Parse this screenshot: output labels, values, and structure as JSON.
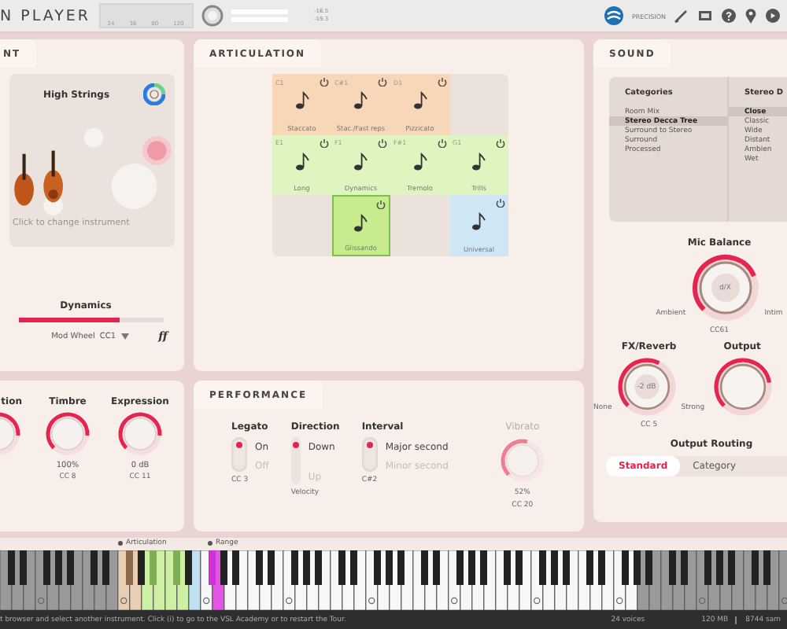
{
  "top_bar": {
    "title": "N PLAYER",
    "meter_ticks": [
      "24",
      "36",
      "80",
      "120"
    ],
    "readings": [
      "-16.5",
      "-19.3"
    ],
    "brand": "PRECISION"
  },
  "instrument_panel": {
    "tab": "NT",
    "name": "High Strings",
    "hint": "Click to change instrument",
    "dynamics": {
      "label": "Dynamics",
      "level": 0.7,
      "controller": "Mod Wheel",
      "cc": "CC1",
      "marking": "ff"
    },
    "knobs": [
      {
        "label": "tion"
      },
      {
        "label": "Timbre",
        "value": "100%",
        "cc": "CC 8"
      },
      {
        "label": "Expression",
        "value": "0 dB",
        "cc": "CC 11"
      }
    ]
  },
  "articulation": {
    "tab": "ARTICULATION",
    "cells": [
      {
        "kind": "articulation",
        "key": "C1",
        "name": "Staccato",
        "color": "#f8d6b8",
        "selected": false
      },
      {
        "kind": "articulation",
        "key": "C#1",
        "name": "Stac./Fast reps",
        "color": "#f8d6b8",
        "selected": false
      },
      {
        "kind": "articulation",
        "key": "D1",
        "name": "Pizzicato",
        "color": "#f8d6b8",
        "selected": false
      },
      {
        "kind": "empty"
      },
      {
        "kind": "articulation",
        "key": "E1",
        "name": "Long",
        "color": "#def5c0",
        "selected": false
      },
      {
        "kind": "articulation",
        "key": "F1",
        "name": "Dynamics",
        "color": "#def5c0",
        "selected": false
      },
      {
        "kind": "articulation",
        "key": "F#1",
        "name": "Tremolo",
        "color": "#def5c0",
        "selected": false
      },
      {
        "kind": "articulation",
        "key": "G1",
        "name": "Trills",
        "color": "#def5c0",
        "selected": false
      },
      {
        "kind": "empty"
      },
      {
        "kind": "articulation",
        "name": "Glissando",
        "color": "#c6ec8e",
        "selected": true
      },
      {
        "kind": "empty"
      },
      {
        "kind": "articulation",
        "name": "Universal",
        "color": "#cfe6f4",
        "selected": false
      }
    ]
  },
  "performance": {
    "tab": "PERFORMANCE",
    "legato": {
      "label": "Legato",
      "options": [
        {
          "label": "On",
          "selected": true
        },
        {
          "label": "Off",
          "selected": false
        }
      ],
      "cc": "CC 3"
    },
    "direction": {
      "label": "Direction",
      "options": [
        {
          "label": "Down",
          "selected": true
        },
        {
          "label": "Up",
          "selected": false
        }
      ],
      "note": "Velocity"
    },
    "interval": {
      "label": "Interval",
      "options": [
        {
          "label": "Major second",
          "selected": true
        },
        {
          "label": "Minor second",
          "selected": false
        }
      ],
      "cc": "C#2"
    },
    "vibrato": {
      "label": "Vibrato",
      "value": "52%",
      "cc": "CC 20",
      "disabled": true
    }
  },
  "sound": {
    "tab": "SOUND",
    "categories": {
      "header": "Categories",
      "items": [
        {
          "label": "Room Mix",
          "selected": false
        },
        {
          "label": "Stereo Decca Tree",
          "selected": true
        },
        {
          "label": "Surround to Stereo",
          "selected": false
        },
        {
          "label": "Surround",
          "selected": false
        },
        {
          "label": "Processed",
          "selected": false
        }
      ]
    },
    "mics": {
      "header": "Stereo D",
      "items": [
        {
          "label": "Close",
          "selected": true
        },
        {
          "label": "Classic",
          "selected": false
        },
        {
          "label": "Wide",
          "selected": false
        },
        {
          "label": "Distant",
          "selected": false
        },
        {
          "label": "Ambien",
          "selected": false
        },
        {
          "label": "Wet",
          "selected": false
        }
      ]
    },
    "mic_balance": {
      "label": "Mic Balance",
      "center": "d/X",
      "left": "Ambient",
      "right": "Intim",
      "cc": "CC61"
    },
    "fx_reverb": {
      "label": "FX/Reverb",
      "center": "-2 dB",
      "left": "None",
      "right": "Strong",
      "cc": "CC 5"
    },
    "output": {
      "label": "Output"
    },
    "routing": {
      "label": "Output Routing",
      "tabs": [
        {
          "label": "Standard",
          "selected": true
        },
        {
          "label": "Category",
          "selected": false
        }
      ]
    }
  },
  "keyboard": {
    "markers": [
      "Articulation",
      "Range"
    ]
  },
  "status_bar": {
    "message": "t browser and select another instrument. Click (i) to go to the VSL Academy or to restart the Tour.",
    "voices": "24 voices",
    "memory": "120 MB",
    "samples": "8744 sam"
  }
}
